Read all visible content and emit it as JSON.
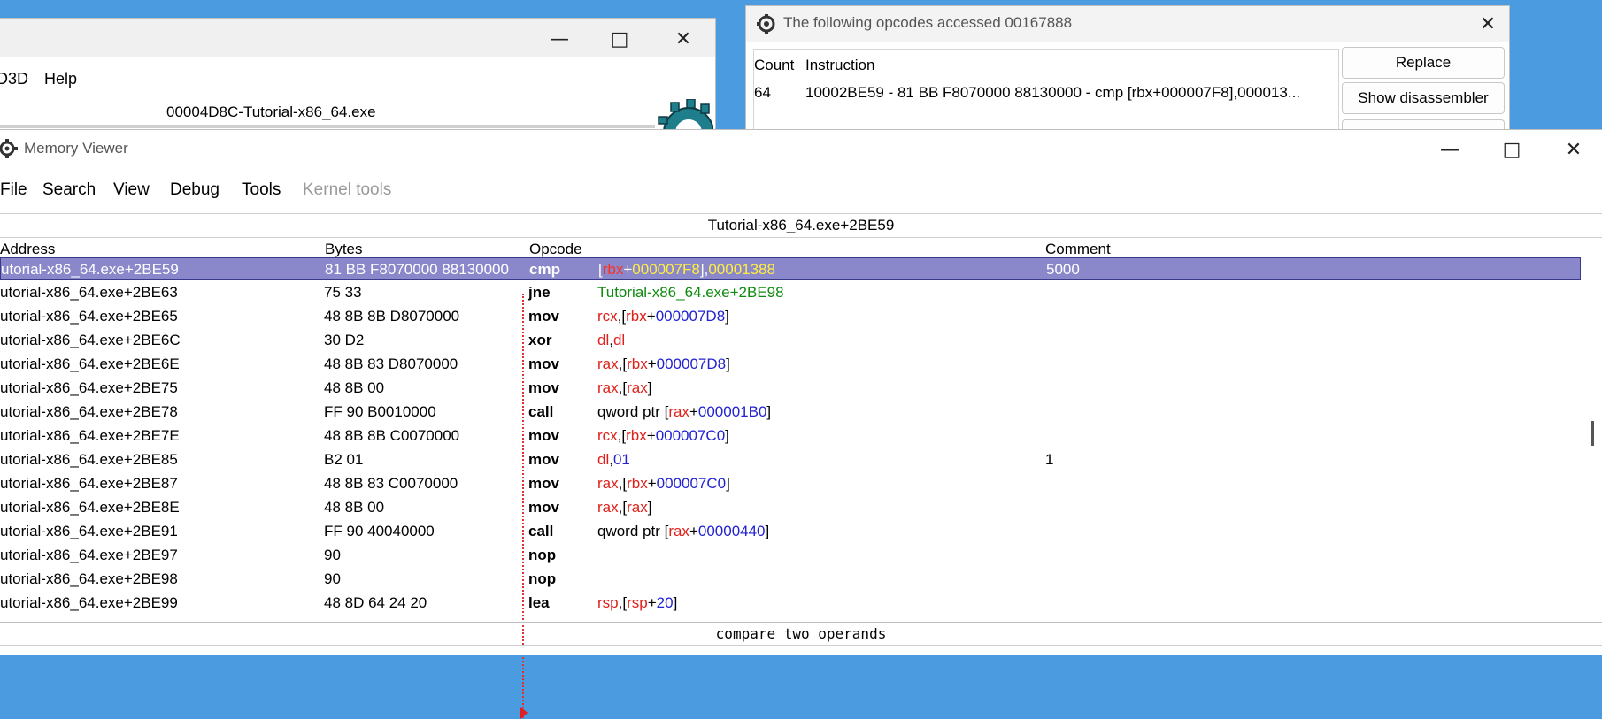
{
  "main_window": {
    "menu": [
      "D3D",
      "Help"
    ],
    "process_title": "00004D8C-Tutorial-x86_64.exe"
  },
  "opcodes_window": {
    "title": "The following opcodes accessed 00167888",
    "columns": [
      "Count",
      "Instruction"
    ],
    "rows": [
      {
        "count": "64",
        "instruction": "10002BE59 - 81 BB F8070000 88130000 - cmp [rbx+000007F8],000013..."
      }
    ],
    "buttons": [
      "Replace",
      "Show disassembler"
    ]
  },
  "memory_viewer": {
    "title": "Memory Viewer",
    "menu": [
      "File",
      "Search",
      "View",
      "Debug",
      "Tools",
      "Kernel tools"
    ],
    "disabled_menu": "Kernel tools",
    "address_bar": "Tutorial-x86_64.exe+2BE59",
    "columns": {
      "address": "Address",
      "bytes": "Bytes",
      "opcode": "Opcode",
      "comment": "Comment"
    },
    "rows": [
      {
        "address": "utorial-x86_64.exe+2BE59",
        "bytes": "81 BB F8070000 88130000",
        "op": "cmp",
        "args": [
          [
            "plain",
            "["
          ],
          [
            "reg",
            "rbx"
          ],
          [
            "plain",
            "+"
          ],
          [
            "hex",
            "000007F8"
          ],
          [
            "plain",
            "],"
          ],
          [
            "hex",
            "00001388"
          ]
        ],
        "comment": "5000",
        "selected": true
      },
      {
        "address": "utorial-x86_64.exe+2BE63",
        "bytes": "75 33",
        "op": "jne",
        "args": [
          [
            "sym",
            "Tutorial-x86_64.exe+2BE98"
          ]
        ],
        "comment": ""
      },
      {
        "address": "utorial-x86_64.exe+2BE65",
        "bytes": "48 8B 8B D8070000",
        "op": "mov",
        "args": [
          [
            "reg",
            "rcx"
          ],
          [
            "plain",
            ",["
          ],
          [
            "reg",
            "rbx"
          ],
          [
            "plain",
            "+"
          ],
          [
            "hex",
            "000007D8"
          ],
          [
            "plain",
            "]"
          ]
        ],
        "comment": ""
      },
      {
        "address": "utorial-x86_64.exe+2BE6C",
        "bytes": "30 D2",
        "op": "xor",
        "args": [
          [
            "reg",
            "dl"
          ],
          [
            "plain",
            ","
          ],
          [
            "reg",
            "dl"
          ]
        ],
        "comment": ""
      },
      {
        "address": "utorial-x86_64.exe+2BE6E",
        "bytes": "48 8B 83 D8070000",
        "op": "mov",
        "args": [
          [
            "reg",
            "rax"
          ],
          [
            "plain",
            ",["
          ],
          [
            "reg",
            "rbx"
          ],
          [
            "plain",
            "+"
          ],
          [
            "hex",
            "000007D8"
          ],
          [
            "plain",
            "]"
          ]
        ],
        "comment": ""
      },
      {
        "address": "utorial-x86_64.exe+2BE75",
        "bytes": "48 8B 00",
        "op": "mov",
        "args": [
          [
            "reg",
            "rax"
          ],
          [
            "plain",
            ",["
          ],
          [
            "reg",
            "rax"
          ],
          [
            "plain",
            "]"
          ]
        ],
        "comment": ""
      },
      {
        "address": "utorial-x86_64.exe+2BE78",
        "bytes": "FF 90 B0010000",
        "op": "call",
        "args": [
          [
            "plain",
            "qword ptr ["
          ],
          [
            "reg",
            "rax"
          ],
          [
            "plain",
            "+"
          ],
          [
            "hex",
            "000001B0"
          ],
          [
            "plain",
            "]"
          ]
        ],
        "comment": ""
      },
      {
        "address": "utorial-x86_64.exe+2BE7E",
        "bytes": "48 8B 8B C0070000",
        "op": "mov",
        "args": [
          [
            "reg",
            "rcx"
          ],
          [
            "plain",
            ",["
          ],
          [
            "reg",
            "rbx"
          ],
          [
            "plain",
            "+"
          ],
          [
            "hex",
            "000007C0"
          ],
          [
            "plain",
            "]"
          ]
        ],
        "comment": ""
      },
      {
        "address": "utorial-x86_64.exe+2BE85",
        "bytes": "B2 01",
        "op": "mov",
        "args": [
          [
            "reg",
            "dl"
          ],
          [
            "plain",
            ","
          ],
          [
            "hex",
            "01"
          ]
        ],
        "comment": "1"
      },
      {
        "address": "utorial-x86_64.exe+2BE87",
        "bytes": "48 8B 83 C0070000",
        "op": "mov",
        "args": [
          [
            "reg",
            "rax"
          ],
          [
            "plain",
            ",["
          ],
          [
            "reg",
            "rbx"
          ],
          [
            "plain",
            "+"
          ],
          [
            "hex",
            "000007C0"
          ],
          [
            "plain",
            "]"
          ]
        ],
        "comment": ""
      },
      {
        "address": "utorial-x86_64.exe+2BE8E",
        "bytes": "48 8B 00",
        "op": "mov",
        "args": [
          [
            "reg",
            "rax"
          ],
          [
            "plain",
            ",["
          ],
          [
            "reg",
            "rax"
          ],
          [
            "plain",
            "]"
          ]
        ],
        "comment": ""
      },
      {
        "address": "utorial-x86_64.exe+2BE91",
        "bytes": "FF 90 40040000",
        "op": "call",
        "args": [
          [
            "plain",
            "qword ptr ["
          ],
          [
            "reg",
            "rax"
          ],
          [
            "plain",
            "+"
          ],
          [
            "hex",
            "00000440"
          ],
          [
            "plain",
            "]"
          ]
        ],
        "comment": ""
      },
      {
        "address": "utorial-x86_64.exe+2BE97",
        "bytes": "90",
        "op": "nop",
        "args": [],
        "comment": ""
      },
      {
        "address": "utorial-x86_64.exe+2BE98",
        "bytes": "90",
        "op": "nop",
        "args": [],
        "comment": ""
      },
      {
        "address": "utorial-x86_64.exe+2BE99",
        "bytes": "48 8D 64 24 20",
        "op": "lea",
        "args": [
          [
            "reg",
            "rsp"
          ],
          [
            "plain",
            ",["
          ],
          [
            "reg",
            "rsp"
          ],
          [
            "plain",
            "+"
          ],
          [
            "hex",
            "20"
          ],
          [
            "plain",
            "]"
          ]
        ],
        "comment": ""
      }
    ],
    "status": "compare two operands"
  },
  "colors": {
    "selection": "#8a87ca",
    "register": "#e0201a",
    "hex_value": "#2222d0",
    "symbol": "#108a10",
    "desktop": "#4a9be0"
  },
  "icons": [
    "cheat-engine-gear-icon",
    "minimize-icon",
    "maximize-icon",
    "close-icon"
  ]
}
